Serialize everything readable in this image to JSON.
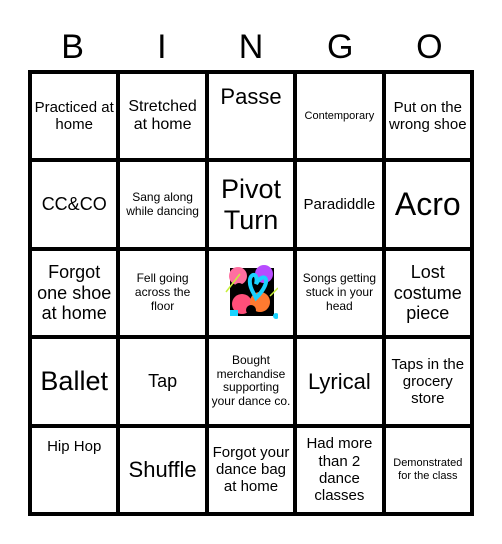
{
  "header": {
    "letters": [
      "B",
      "I",
      "N",
      "G",
      "O"
    ]
  },
  "cells": [
    {
      "text": "Practiced at home"
    },
    {
      "text": "Stretched at home"
    },
    {
      "text": "Passe"
    },
    {
      "text": "Contemporary"
    },
    {
      "text": "Put on the wrong shoe"
    },
    {
      "text": "CC&CO"
    },
    {
      "text": "Sang along while dancing"
    },
    {
      "text": "Pivot Turn"
    },
    {
      "text": "Paradiddle"
    },
    {
      "text": "Acro"
    },
    {
      "text": "Forgot one shoe at home"
    },
    {
      "text": "Fell going across the floor"
    },
    {
      "text": "",
      "icon": "free-space-logo"
    },
    {
      "text": "Songs getting stuck in your head"
    },
    {
      "text": "Lost costume piece"
    },
    {
      "text": "Ballet"
    },
    {
      "text": "Tap"
    },
    {
      "text": "Bought merchandise supporting your dance co."
    },
    {
      "text": "Lyrical"
    },
    {
      "text": "Taps in the grocery store"
    },
    {
      "text": "Hip Hop"
    },
    {
      "text": "Shuffle"
    },
    {
      "text": "Forgot your dance bag at home"
    },
    {
      "text": "Had more than 2 dance classes"
    },
    {
      "text": "Demonstrated for the class"
    }
  ]
}
